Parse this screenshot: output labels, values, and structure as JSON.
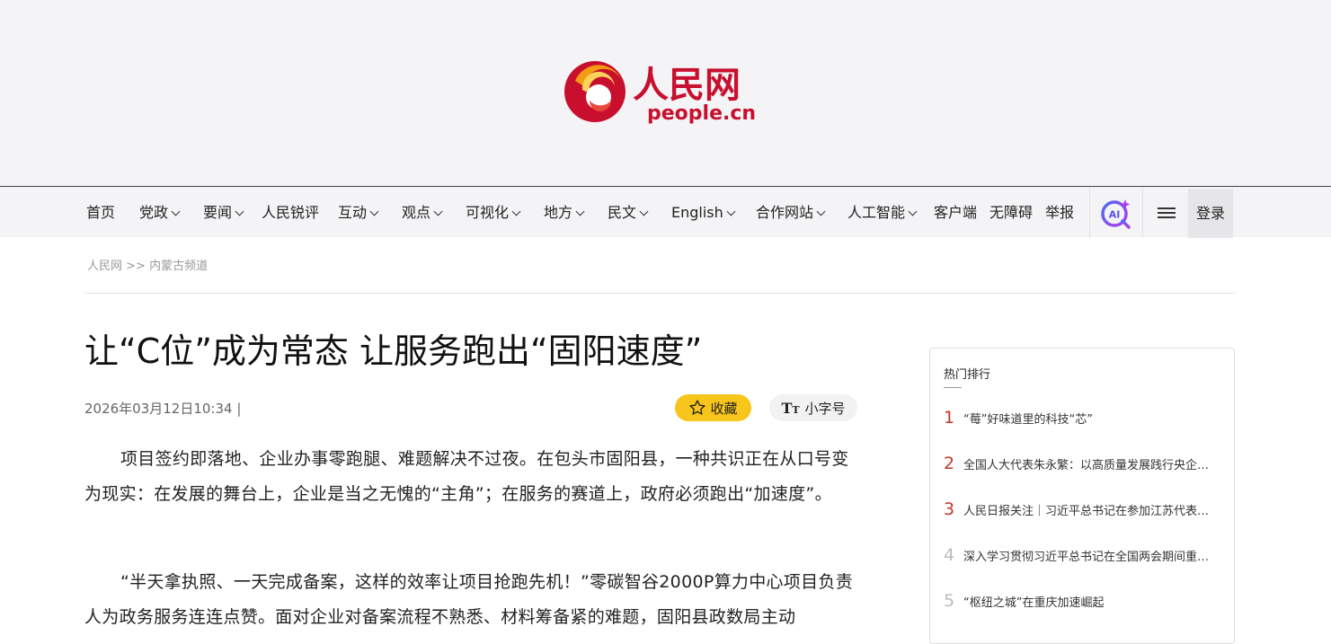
{
  "header": {
    "logo_cn": "人民网",
    "logo_en": "people.cn"
  },
  "nav": {
    "items": [
      {
        "label": "首页",
        "dropdown": false
      },
      {
        "label": "党政",
        "dropdown": true
      },
      {
        "label": "要闻",
        "dropdown": true
      },
      {
        "label": "人民锐评",
        "dropdown": false
      },
      {
        "label": "互动",
        "dropdown": true
      },
      {
        "label": "观点",
        "dropdown": true
      },
      {
        "label": "可视化",
        "dropdown": true
      },
      {
        "label": "地方",
        "dropdown": true
      },
      {
        "label": "民文",
        "dropdown": true
      },
      {
        "label": "English",
        "dropdown": true
      },
      {
        "label": "合作网站",
        "dropdown": true
      },
      {
        "label": "人工智能",
        "dropdown": true
      },
      {
        "label": "客户端",
        "dropdown": false
      },
      {
        "label": "无障碍",
        "dropdown": false
      },
      {
        "label": "举报",
        "dropdown": false
      }
    ],
    "ai_label": "AI",
    "login_label": "登录"
  },
  "breadcrumb": {
    "home": "人民网",
    "separator": ">>",
    "channel": "内蒙古频道"
  },
  "article": {
    "title": "让“C位”成为常态 让服务跑出“固阳速度”",
    "dateline": "2026年03月12日10:34 |",
    "favorite_label": "收藏",
    "font_size_label": "小字号",
    "paragraphs": [
      "项目签约即落地、企业办事零跑腿、难题解决不过夜。在包头市固阳县，一种共识正在从口号变为现实：在发展的舞台上，企业是当之无愧的“主角”；在服务的赛道上，政府必须跑出“加速度”。",
      "“半天拿执照、一天完成备案，这样的效率让项目抢跑先机！”零碳智谷2000P算力中心项目负责人为政务服务连连点赞。面对企业对备案流程不熟悉、材料筹备紧的难题，固阳县政数局主动"
    ]
  },
  "sidebar": {
    "title": "热门排行",
    "items": [
      {
        "rank": "1",
        "text": "“莓”好味道里的科技“芯”"
      },
      {
        "rank": "2",
        "text": "全国人大代表朱永繁：以高质量发展践行央企担当"
      },
      {
        "rank": "3",
        "text": "人民日报关注｜习近平总书记在参加江苏代表团审议时"
      },
      {
        "rank": "4",
        "text": "深入学习贯彻习近平总书记在全国两会期间重要讲话"
      },
      {
        "rank": "5",
        "text": "“枢纽之城”在重庆加速崛起"
      }
    ],
    "accent_color": "#c0392b"
  }
}
